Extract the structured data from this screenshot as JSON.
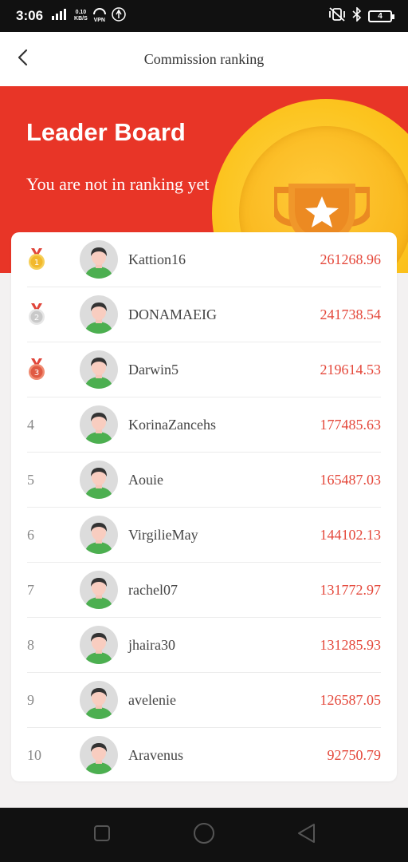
{
  "status_bar": {
    "time": "3:06",
    "network_type": "4G",
    "speed_value": "0.10",
    "speed_unit": "KB/S",
    "vpn": "VPN",
    "battery": "4"
  },
  "header": {
    "title": "Commission ranking",
    "back_icon": "chevron-left-icon"
  },
  "hero": {
    "title": "Leader Board",
    "subtitle": "You are not in ranking yet",
    "colors": {
      "background": "#e83527",
      "coin": "#fcc41f",
      "trophy": "#f0972a"
    }
  },
  "leaderboard": {
    "rows": [
      {
        "rank": "1",
        "medal": "gold-medal-icon",
        "name": "Kattion16",
        "amount": "261268.96"
      },
      {
        "rank": "2",
        "medal": "silver-medal-icon",
        "name": "DONAMAEIG",
        "amount": "241738.54"
      },
      {
        "rank": "3",
        "medal": "bronze-medal-icon",
        "name": "Darwin5",
        "amount": "219614.53"
      },
      {
        "rank": "4",
        "name": "KorinaZancehs",
        "amount": "177485.63"
      },
      {
        "rank": "5",
        "name": "Aouie",
        "amount": "165487.03"
      },
      {
        "rank": "6",
        "name": "VirgilieMay",
        "amount": "144102.13"
      },
      {
        "rank": "7",
        "name": "rachel07",
        "amount": "131772.97"
      },
      {
        "rank": "8",
        "name": "jhaira30",
        "amount": "131285.93"
      },
      {
        "rank": "9",
        "name": "avelenie",
        "amount": "126587.05"
      },
      {
        "rank": "10",
        "name": "Aravenus",
        "amount": "92750.79"
      }
    ],
    "currency_symbol": "",
    "amount_color": "#e4473a"
  },
  "nav_bar": {
    "icons": [
      "recent-apps-icon",
      "home-icon",
      "back-icon"
    ]
  }
}
